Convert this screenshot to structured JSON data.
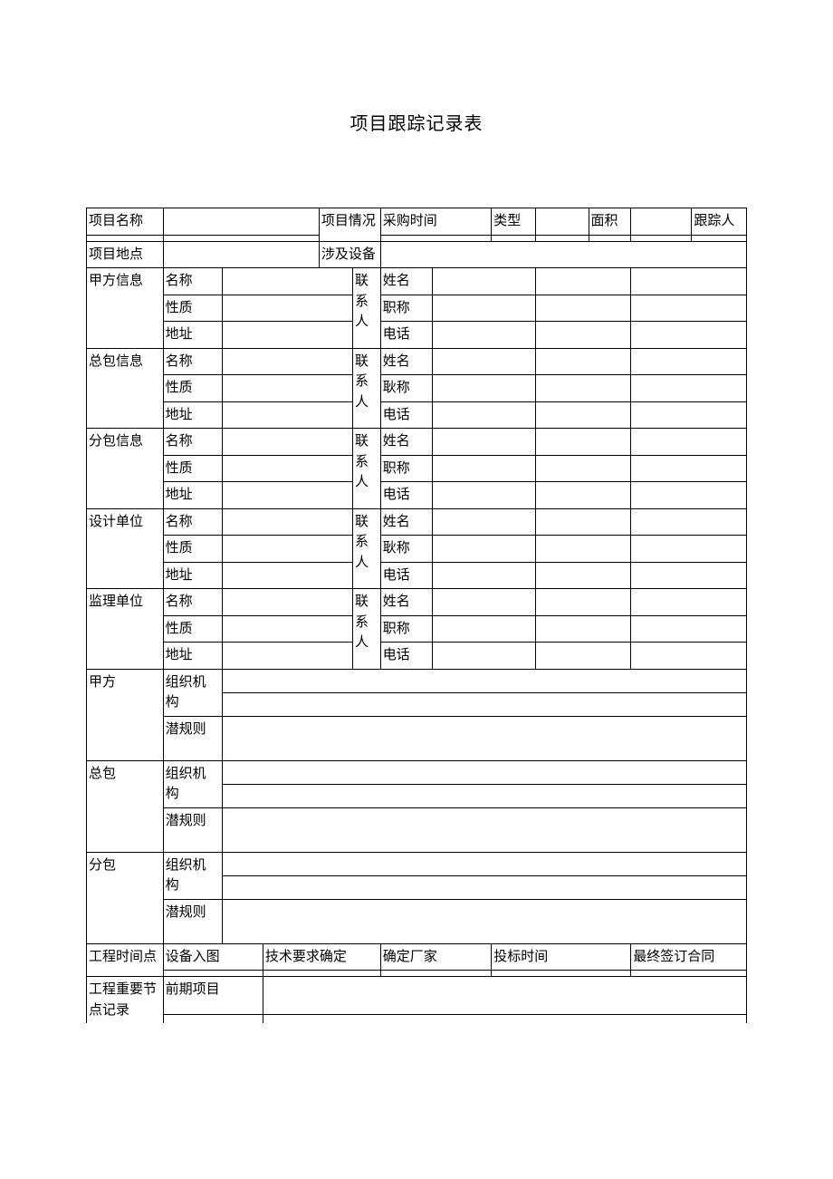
{
  "title": "项目跟踪记录表",
  "row1": {
    "projName": "项目名称",
    "projInfo": "项目情况",
    "purchaseTime": "采购时间",
    "type": "类型",
    "area": "面积",
    "tracker": "跟踪人"
  },
  "row2": {
    "projLoc": "项目地点",
    "equip": "涉及设备"
  },
  "party": {
    "a": {
      "label": "甲方信息",
      "name": "名称",
      "nature": "性质",
      "addr": "地址",
      "contact": "联系人",
      "pName": "姓名",
      "pTitle": "职称",
      "pPhone": "电话"
    },
    "gen": {
      "label": "总包信息",
      "name": "名称",
      "nature": "性质",
      "addr": "地址",
      "contact": "联系人",
      "pName": "姓名",
      "pTitle": "耿称",
      "pPhone": "电话"
    },
    "sub": {
      "label": "分包信息",
      "name": "名称",
      "nature": "性质",
      "addr": "地址",
      "contact": "联系人",
      "pName": "姓名",
      "pTitle": "职称",
      "pPhone": "电话"
    },
    "des": {
      "label": "设计单位",
      "name": "名称",
      "nature": "性质",
      "addr": "地址",
      "contact": "联系人",
      "pName": "姓名",
      "pTitle": "耿称",
      "pPhone": "电话"
    },
    "sup": {
      "label": "监理单位",
      "name": "名称",
      "nature": "性质",
      "addr": "地址",
      "contact": "联系人",
      "pName": "姓名",
      "pTitle": "职称",
      "pPhone": "电话"
    }
  },
  "org": {
    "a": {
      "label": "甲方",
      "struct": "组织机构",
      "rule": "潜规则"
    },
    "gen": {
      "label": "总包",
      "struct": "组织机构",
      "rule": "潜规则"
    },
    "sub": {
      "label": "分包",
      "struct": "组织机构",
      "rule": "潜规则"
    }
  },
  "timeline": {
    "label": "工程时间点",
    "equipIn": "设备入图",
    "techReq": "技术要求确定",
    "vendor": "确定厂家",
    "bidTime": "投标时间",
    "final": "最终签订合同"
  },
  "milestone": {
    "label": "工程重要节点记录",
    "prev": "前期项目"
  }
}
